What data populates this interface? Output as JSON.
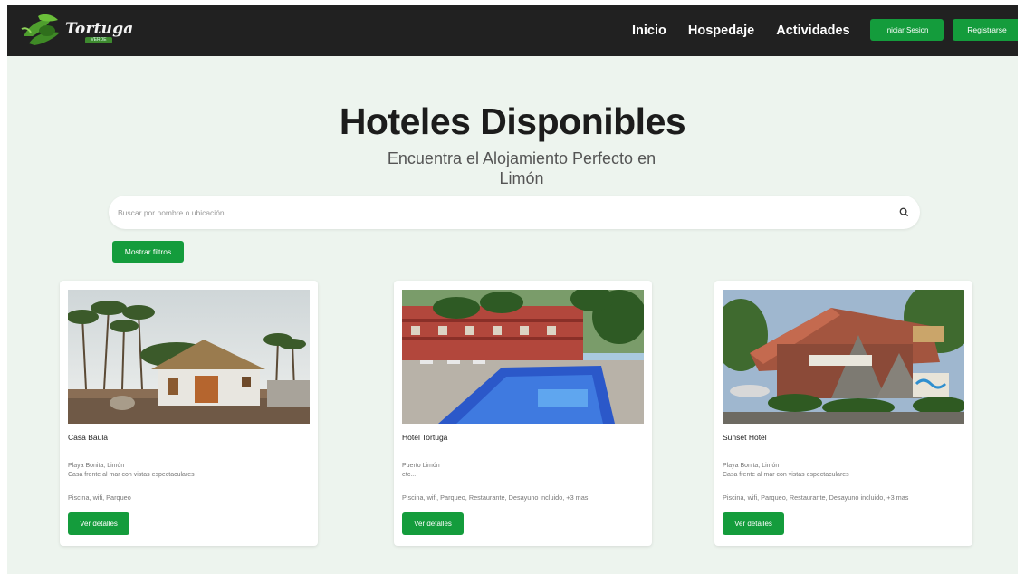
{
  "brand": {
    "name": "Tortuga",
    "sub": "VERDE"
  },
  "nav": {
    "links": [
      "Inicio",
      "Hospedaje",
      "Actividades"
    ],
    "login": "Iniciar Sesion",
    "register": "Registrarse"
  },
  "hero": {
    "title": "Hoteles Disponibles",
    "subtitle_line1": "Encuentra el Alojamiento Perfecto en",
    "subtitle_line2": "Limón"
  },
  "search": {
    "placeholder": "Buscar por nombre o ubicación",
    "value": ""
  },
  "filters_button": "Mostrar filtros",
  "cards": [
    {
      "name": "Casa Baula",
      "location": "Playa Bonita, Limón",
      "description": "Casa frente al mar con vistas espectaculares",
      "amenities": "Piscina, wifi, Parqueo",
      "button": "Ver detalles"
    },
    {
      "name": "Hotel Tortuga",
      "location": "Puerto Limón",
      "description": "etc...",
      "amenities": "Piscina, wifi, Parqueo, Restaurante, Desayuno incluido, +3 mas",
      "button": "Ver detalles"
    },
    {
      "name": "Sunset Hotel",
      "location": "Playa Bonita, Limón",
      "description": "Casa frente al mar con vistas espectaculares",
      "amenities": "Piscina, wifi, Parqueo, Restaurante, Desayuno incluido, +3 mas",
      "button": "Ver detalles"
    }
  ],
  "colors": {
    "navbar": "#212121",
    "accent": "#149c3c",
    "background": "#edf4ee"
  },
  "icons": {
    "search": "search-icon",
    "logo": "turtle-logo-icon"
  }
}
